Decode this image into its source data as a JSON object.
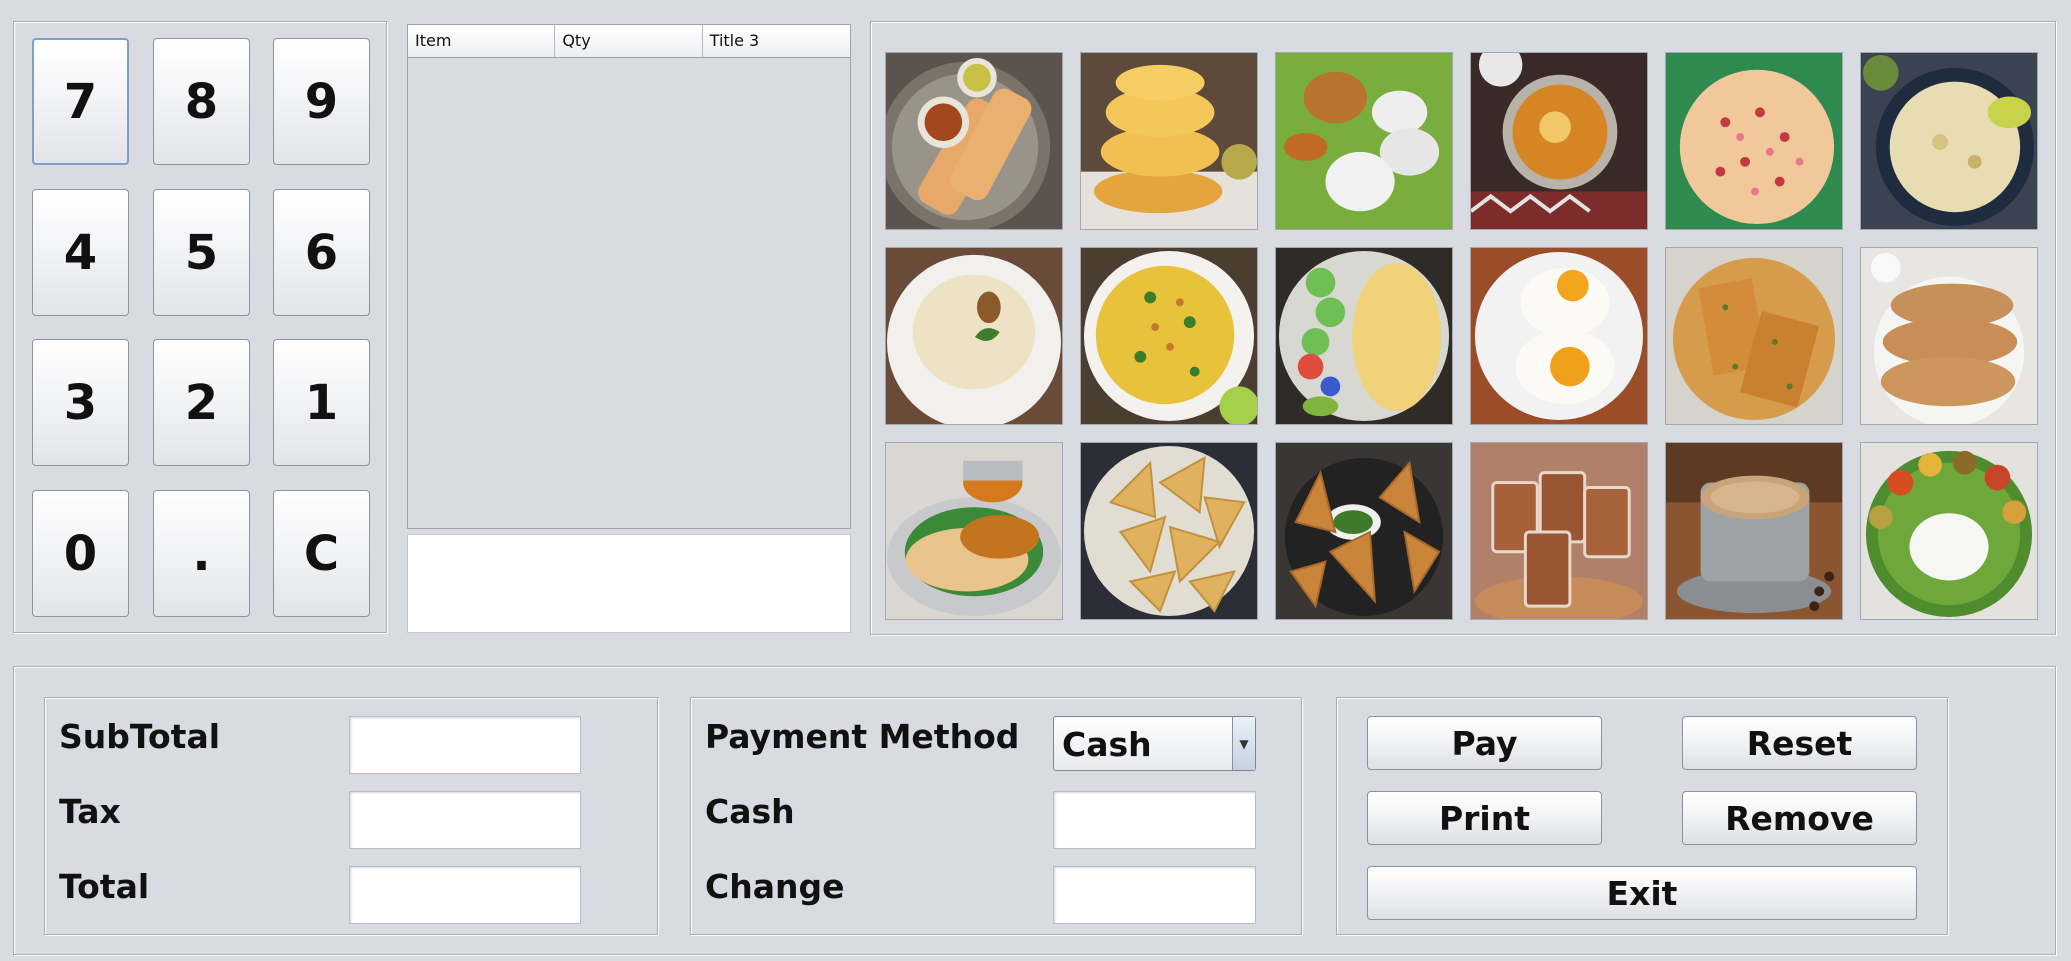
{
  "keypad": {
    "keys": [
      "7",
      "8",
      "9",
      "4",
      "5",
      "6",
      "3",
      "2",
      "1",
      "0",
      ".",
      "C"
    ]
  },
  "order_table": {
    "columns": [
      "Item",
      "Qty",
      "Title 3"
    ],
    "rows": []
  },
  "menu": {
    "items": [
      {
        "icon": "dosa-image"
      },
      {
        "icon": "poori-image"
      },
      {
        "icon": "idli-vada-image"
      },
      {
        "icon": "curry-bowl-image"
      },
      {
        "icon": "uttapam-image"
      },
      {
        "icon": "upma-bowl-image"
      },
      {
        "icon": "pongal-image"
      },
      {
        "icon": "lemon-rice-image"
      },
      {
        "icon": "omelette-plate-image"
      },
      {
        "icon": "fried-eggs-image"
      },
      {
        "icon": "paratha-image"
      },
      {
        "icon": "chapati-image"
      },
      {
        "icon": "parotta-curry-image"
      },
      {
        "icon": "samosa-plate-image"
      },
      {
        "icon": "samosa-chutney-image"
      },
      {
        "icon": "chai-glasses-image"
      },
      {
        "icon": "filter-coffee-image"
      },
      {
        "icon": "rice-meals-image"
      }
    ]
  },
  "totals": {
    "subtotal_label": "SubTotal",
    "tax_label": "Tax",
    "total_label": "Total"
  },
  "payment": {
    "method_label": "Payment Method",
    "method_value": "Cash",
    "cash_label": "Cash",
    "change_label": "Change"
  },
  "actions": {
    "pay": "Pay",
    "reset": "Reset",
    "print": "Print",
    "remove": "Remove",
    "exit": "Exit"
  }
}
